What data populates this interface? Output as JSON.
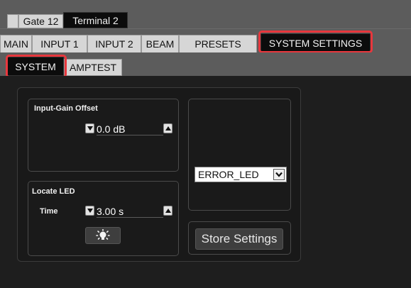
{
  "top_tabs": [
    "Gate 12",
    "Terminal 2"
  ],
  "main_tabs": [
    "MAIN",
    "INPUT 1",
    "INPUT 2",
    "BEAM",
    "PRESETS",
    "SYSTEM SETTINGS"
  ],
  "sub_tabs": [
    "SYSTEM",
    "AMPTEST"
  ],
  "input_gain": {
    "label": "Input-Gain Offset",
    "value": "0.0 dB"
  },
  "locate_led": {
    "label": "Locate LED",
    "time_label": "Time",
    "time_value": "3.00 s"
  },
  "error_select": {
    "value": "ERROR_LED"
  },
  "store_button": "Store Settings",
  "colors": {
    "highlight": "#e8373d",
    "active_tab": "#0c0c0c",
    "panel_bg": "#1e1e1e"
  }
}
